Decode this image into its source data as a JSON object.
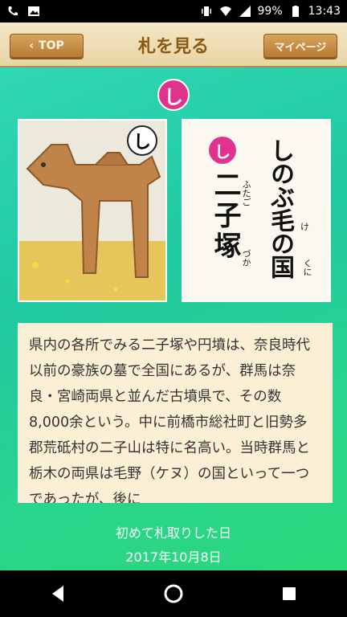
{
  "status": {
    "battery": "99%",
    "time": "13:43"
  },
  "header": {
    "top_label": "TOP",
    "title": "札を見る",
    "mypage_label": "マイページ"
  },
  "card": {
    "hiragana": "し",
    "image_badge": "し",
    "text_badge": "し",
    "line1": "しのぶ毛の国",
    "line2": "二子塚",
    "ruby_ke": "け",
    "ruby_kuni": "くに",
    "ruby_futago": "ふたご",
    "ruby_zuka": "づか"
  },
  "description": "県内の各所でみる二子塚や円墳は、奈良時代以前の豪族の墓で全国にあるが、群馬は奈良・宮崎両県と並んだ古墳県で、その数8,000余という。中に前橋市総社町と旧勢多郡荒砥村の二子山は特に名高い。当時群馬と栃木の両県は毛野（ケヌ）の国といって一つであったが、後に",
  "first_taken": {
    "label": "初めて札取りした日",
    "date": "2017年10月8日"
  },
  "icons": {
    "back": "back-triangle-icon",
    "home": "home-circle-icon",
    "recent": "recent-square-icon"
  },
  "colors": {
    "accent": "#e0338f",
    "teal": "#20c9a0"
  }
}
